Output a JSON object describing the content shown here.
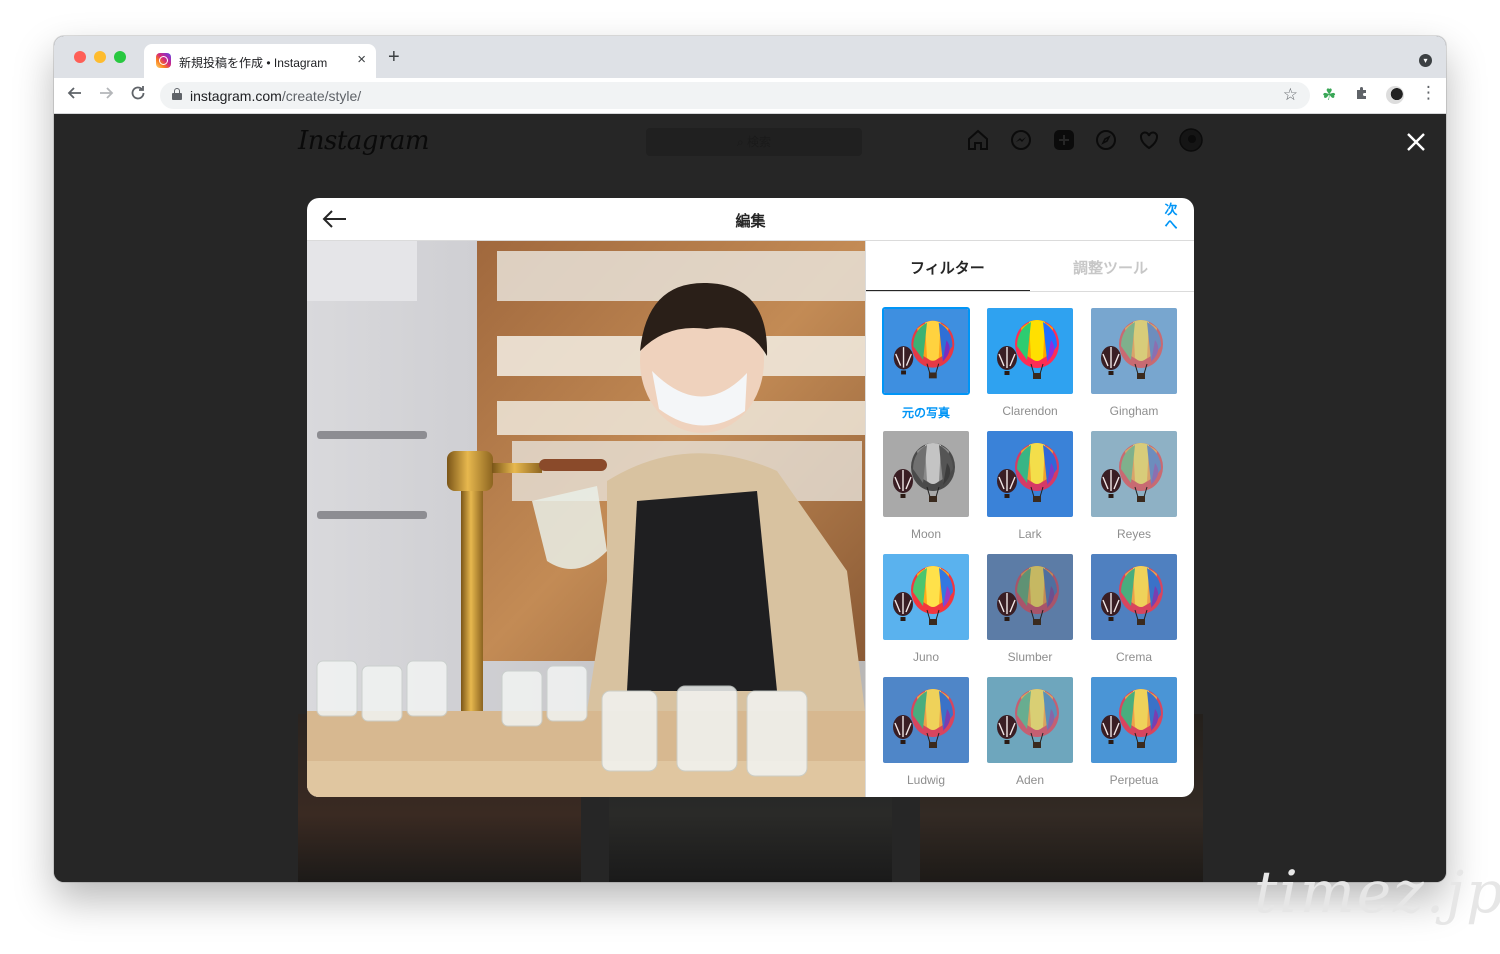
{
  "browser": {
    "tab_title": "新規投稿を作成 • Instagram",
    "tab_close": "×",
    "new_tab": "+",
    "url_host": "instagram.com",
    "url_path": "/create/style/",
    "menu_arrow": "▾",
    "kebab": "⋮",
    "icons": {
      "back": "back-arrow-icon",
      "forward": "forward-arrow-icon",
      "reload": "reload-icon",
      "lock": "lock-icon",
      "star": "bookmark-star-icon",
      "extension_clover": "clover-icon",
      "extensions": "puzzle-icon"
    }
  },
  "instagram": {
    "logo": "Instagram",
    "search_placeholder": "⌕ 検索",
    "nav_icons": [
      "home-icon",
      "messenger-icon",
      "new-post-icon",
      "explore-icon",
      "activity-heart-icon",
      "profile-avatar-icon"
    ]
  },
  "modal": {
    "title": "編集",
    "next_label": "次へ",
    "tabs": {
      "filters": "フィルター",
      "adjustments": "調整ツール"
    },
    "active_tab": "filters",
    "accent_color": "#0095f6",
    "filters": [
      {
        "name": "元の写真",
        "selected": true,
        "sky": "#3e8fe0",
        "tint": "none"
      },
      {
        "name": "Clarendon",
        "selected": false,
        "sky": "#2fa2f0",
        "tint": "vivid"
      },
      {
        "name": "Gingham",
        "selected": false,
        "sky": "#78a6cf",
        "tint": "faded"
      },
      {
        "name": "Moon",
        "selected": false,
        "sky": "#a9a9a9",
        "tint": "mono"
      },
      {
        "name": "Lark",
        "selected": false,
        "sky": "#3a82d8",
        "tint": "cool"
      },
      {
        "name": "Reyes",
        "selected": false,
        "sky": "#8eb1c5",
        "tint": "faded"
      },
      {
        "name": "Juno",
        "selected": false,
        "sky": "#5ab2ee",
        "tint": "warm"
      },
      {
        "name": "Slumber",
        "selected": false,
        "sky": "#5c7ca6",
        "tint": "muted"
      },
      {
        "name": "Crema",
        "selected": false,
        "sky": "#4f80c0",
        "tint": "soft"
      },
      {
        "name": "Ludwig",
        "selected": false,
        "sky": "#4f86c8",
        "tint": "soft"
      },
      {
        "name": "Aden",
        "selected": false,
        "sky": "#6ea6bd",
        "tint": "aqua"
      },
      {
        "name": "Perpetua",
        "selected": false,
        "sky": "#4a95d6",
        "tint": "soft"
      }
    ]
  },
  "watermark": "timez.jp"
}
